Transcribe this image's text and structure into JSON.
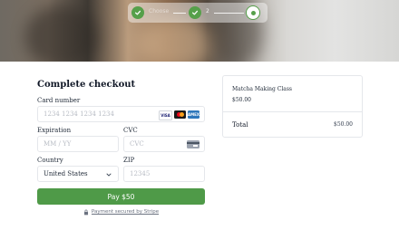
{
  "stepper": {
    "step1_label": "Choose",
    "step2_label": "2",
    "steps_completed": 2,
    "accent_color": "#56a04a"
  },
  "checkout": {
    "title": "Complete checkout",
    "card_number_label": "Card number",
    "card_number_placeholder": "1234 1234 1234 1234",
    "card_brands": [
      "VISA",
      "Mastercard",
      "AMEX"
    ],
    "expiration_label": "Expiration",
    "expiration_placeholder": "MM / YY",
    "cvc_label": "CVC",
    "cvc_placeholder": "CVC",
    "country_label": "Country",
    "country_value": "United States",
    "zip_label": "ZIP",
    "zip_placeholder": "12345",
    "pay_button_label": "Pay $50",
    "pay_button_color": "#4f9a48",
    "secured_text": "Payment secured by Stripe"
  },
  "summary": {
    "item_name": "Matcha Making Class",
    "item_price": "$50.00",
    "total_label": "Total",
    "total_value": "$50.00"
  }
}
